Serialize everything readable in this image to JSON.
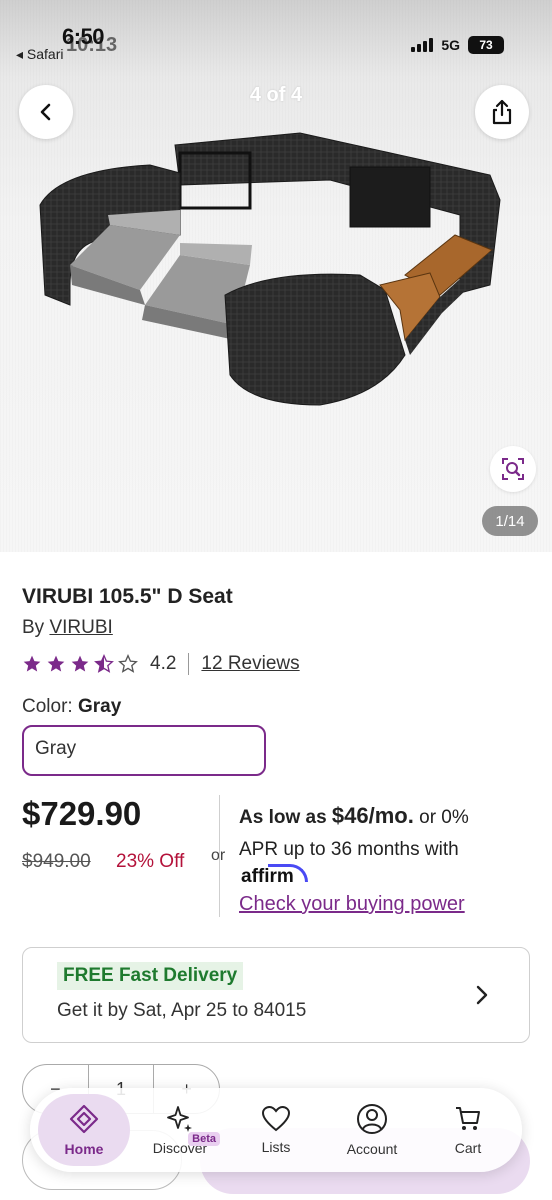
{
  "status_bar": {
    "time": "6:50",
    "time_ghost": "10:13",
    "back_app": "◂ Safari",
    "network": "5G",
    "battery": "73"
  },
  "gallery": {
    "page_indicator": "4 of 4",
    "counter": "1/14"
  },
  "product": {
    "title": "VIRUBI 105.5\" D Seat",
    "by_prefix": "By ",
    "brand": "VIRUBI",
    "rating": "4.2",
    "rating_value": 4.2,
    "reviews": "12 Reviews",
    "color_label": "Color: ",
    "color_value": "Gray",
    "color_select": "Gray"
  },
  "pricing": {
    "price": "$729.90",
    "old_price": "$949.00",
    "discount": "23% Off",
    "or": "or",
    "as_low_as": "As low as ",
    "monthly": "$46/mo.",
    "or_apr": " or 0%",
    "apr_line": "APR up to 36 months with",
    "affirm": "affirm",
    "buying_power": "Check your buying power"
  },
  "delivery": {
    "badge": "FREE Fast Delivery",
    "text": "Get it by Sat, Apr 25 to 84015"
  },
  "quantity": {
    "minus": "−",
    "value": "1",
    "plus": "+"
  },
  "tabs": [
    {
      "label": "Home",
      "icon": "home-icon"
    },
    {
      "label": "Discover",
      "icon": "sparkle-icon",
      "badge": "Beta"
    },
    {
      "label": "Lists",
      "icon": "heart-icon"
    },
    {
      "label": "Account",
      "icon": "account-icon"
    },
    {
      "label": "Cart",
      "icon": "cart-icon"
    }
  ],
  "colors": {
    "accent": "#7b2a8a",
    "discount": "#b4123a",
    "delivery_green": "#1e7a2e",
    "active_tab_bg": "#eadbf0"
  }
}
